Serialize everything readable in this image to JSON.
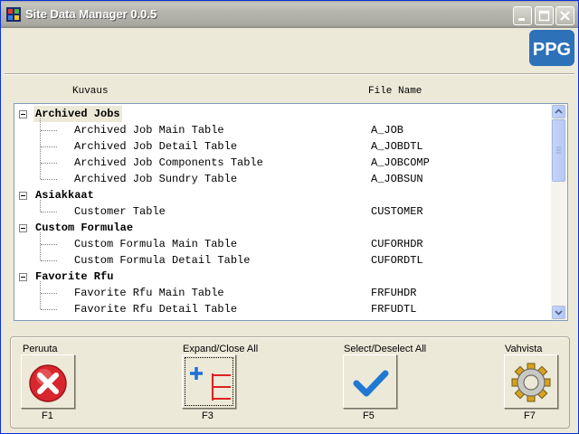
{
  "window": {
    "title": "Site Data Manager 0.0.5",
    "logo_text": "PPG",
    "accent_color": "#2d71b9"
  },
  "columns": {
    "description": "Kuvaus",
    "file_name": "File Name"
  },
  "tree": [
    {
      "label": "Archived Jobs",
      "selected": true,
      "children": [
        {
          "label": "Archived Job Main Table",
          "file": "A_JOB"
        },
        {
          "label": "Archived Job Detail Table",
          "file": "A_JOBDTL"
        },
        {
          "label": "Archived Job Components Table",
          "file": "A_JOBCOMP"
        },
        {
          "label": "Archived Job Sundry Table",
          "file": "A_JOBSUN"
        }
      ]
    },
    {
      "label": "Asiakkaat",
      "children": [
        {
          "label": "Customer Table",
          "file": "CUSTOMER"
        }
      ]
    },
    {
      "label": "Custom Formulae",
      "children": [
        {
          "label": "Custom Formula Main Table",
          "file": "CUFORHDR"
        },
        {
          "label": "Custom Formula Detail Table",
          "file": "CUFORDTL"
        }
      ]
    },
    {
      "label": "Favorite Rfu",
      "children": [
        {
          "label": "Favorite Rfu Main Table",
          "file": "FRFUHDR"
        },
        {
          "label": "Favorite Rfu Detail Table",
          "file": "FRFUDTL"
        }
      ]
    }
  ],
  "actions": {
    "cancel": {
      "caption": "Peruuta",
      "key": "F1",
      "icon": "cancel-x-icon"
    },
    "expand": {
      "caption": "Expand/Close All",
      "key": "F3",
      "icon": "expand-tree-icon"
    },
    "select": {
      "caption": "Select/Deselect All",
      "key": "F5",
      "icon": "checkmark-icon"
    },
    "confirm": {
      "caption": "Vahvista",
      "key": "F7",
      "icon": "gear-icon"
    }
  }
}
